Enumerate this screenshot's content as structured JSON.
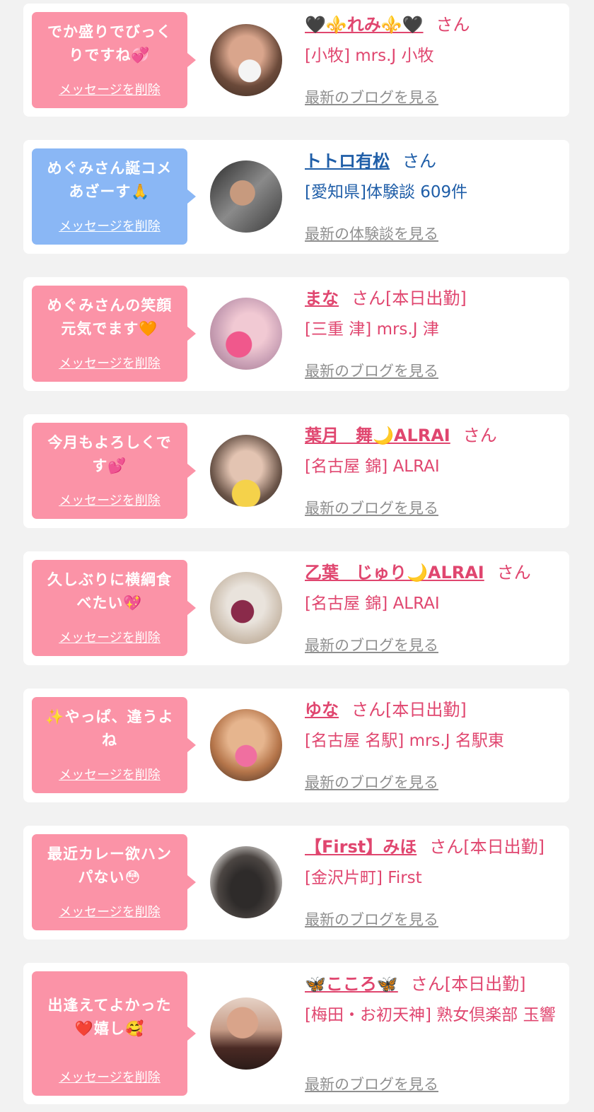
{
  "delete_label": "メッセージを削除",
  "cards": [
    {
      "msg": "でか盛りでびっくりですね💞",
      "name": "🖤⚜️れみ⚜️🖤",
      "suffix": "さん",
      "shop": "[小牧] mrs.J 小牧",
      "link": "最新のブログを見る"
    },
    {
      "msg": "めぐみさん誕コメあざーす🙏",
      "name": "トトロ有松",
      "suffix": "さん",
      "shop": "[愛知県]体験談 609件",
      "link": "最新の体験談を見る"
    },
    {
      "msg": "めぐみさんの笑顔元気でます🧡",
      "name": "まな",
      "suffix": "さん[本日出勤]",
      "shop": "[三重 津] mrs.J 津",
      "link": "最新のブログを見る"
    },
    {
      "msg": "今月もよろしくです💕",
      "name": "葉月　舞🌙ALRAI",
      "suffix": "さん",
      "shop": "[名古屋 錦] ALRAI",
      "link": "最新のブログを見る"
    },
    {
      "msg": "久しぶりに横綱食べたい💖",
      "name": "乙葉　じゅり🌙ALRAI",
      "suffix": "さん",
      "shop": "[名古屋 錦] ALRAI",
      "link": "最新のブログを見る"
    },
    {
      "msg": "✨やっぱ、違うよね",
      "name": "ゆな",
      "suffix": "さん[本日出勤]",
      "shop": "[名古屋 名駅] mrs.J 名駅東",
      "link": "最新のブログを見る"
    },
    {
      "msg": "最近カレー欲ハンパない😳",
      "name": "【First】みほ",
      "suffix": "さん[本日出勤]",
      "shop": "[金沢片町] First",
      "link": "最新のブログを見る"
    },
    {
      "msg": "出逢えてよかった❤️嬉し🥰",
      "name": "🦋こころ🦋",
      "suffix": "さん[本日出勤]",
      "shop": "[梅田・お初天神] 熟女倶楽部 玉響",
      "link": "最新のブログを見る"
    }
  ],
  "colors": {
    "pink": "#fb93a7",
    "blue": "#8ab7f5",
    "name_pink": "#e0466f",
    "name_blue": "#1f5ea8",
    "link_gray": "#8f8f8f"
  }
}
